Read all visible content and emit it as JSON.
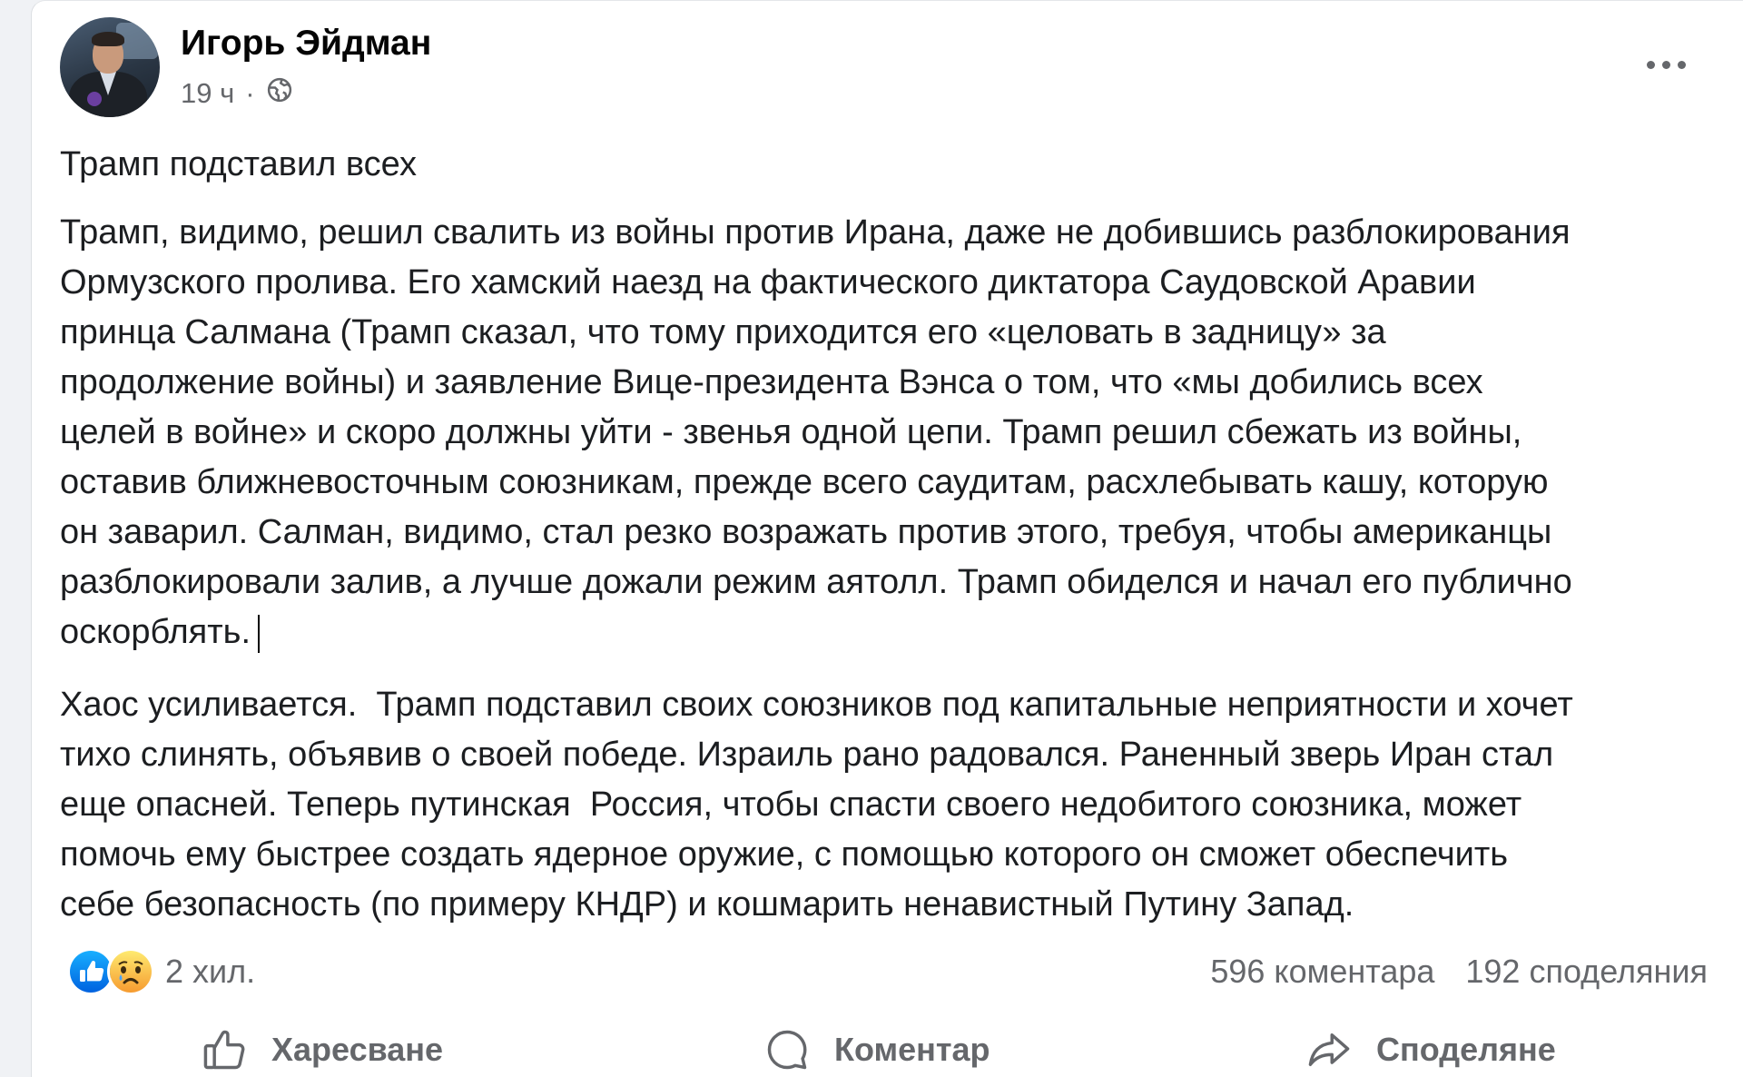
{
  "post": {
    "author": "Игорь Эйдман",
    "time": "19 ч",
    "separator": "·",
    "privacy_icon": "globe-icon",
    "menu_icon": "more-dots-icon",
    "avatar_icon": "author-avatar"
  },
  "body": {
    "paragraphs": [
      [
        "Трамп подставил всех"
      ],
      [
        "Трамп, видимо, решил свалить из войны против Ирана, даже не добившись разблокирования",
        "Ормузского пролива. Его хамский наезд на фактического диктатора Саудовской Аравии",
        "принца Салмана (Трамп сказал, что тому приходится его «целовать в задницу» за",
        "продолжение войны) и заявление Вице-президента Вэнса о том, что «мы добились всех",
        "целей в войне» и скоро должны уйти - звенья одной цепи. Трамп решил сбежать из войны,",
        "оставив ближневосточным союзникам, прежде всего саудитам, расхлебывать кашу, которую",
        "он заварил. Салман, видимо, стал резко возражать против этого, требуя, чтобы американцы",
        "разблокировали залив, а лучше дожали режим аятолл. Трамп обиделся и начал его публично",
        "оскорблять."
      ],
      [
        "Хаос усиливается.  Трамп подставил своих союзников под капитальные неприятности и хочет",
        "тихо слинять, объявив о своей победе. Израиль рано радовался. Раненный зверь Иран стал",
        "еще опасней. Теперь путинская  Россия, чтобы спасти своего недобитого союзника, может",
        "помочь ему быстрее создать ядерное оружие, с помощью которого он сможет обеспечить",
        "себе безопасность (по примеру КНДР) и кошмарить ненавистный Путину Запад."
      ]
    ]
  },
  "reactions": {
    "icons": [
      "like-reaction-icon",
      "sad-reaction-icon"
    ],
    "count": "2 хил."
  },
  "stats": {
    "comments": "596 коментара",
    "shares": "192 споделяния"
  },
  "actions": [
    {
      "label": "Харесване",
      "icon": "thumbs-up-icon"
    },
    {
      "label": "Коментар",
      "icon": "comment-bubble-icon"
    },
    {
      "label": "Споделяне",
      "icon": "share-arrow-icon"
    }
  ],
  "colors": {
    "text": "#1c1e21",
    "secondary": "#65676b",
    "like_blue": "#1877f2",
    "sad_yellow": "#f7b125",
    "page_bg": "#f0f2f5"
  }
}
